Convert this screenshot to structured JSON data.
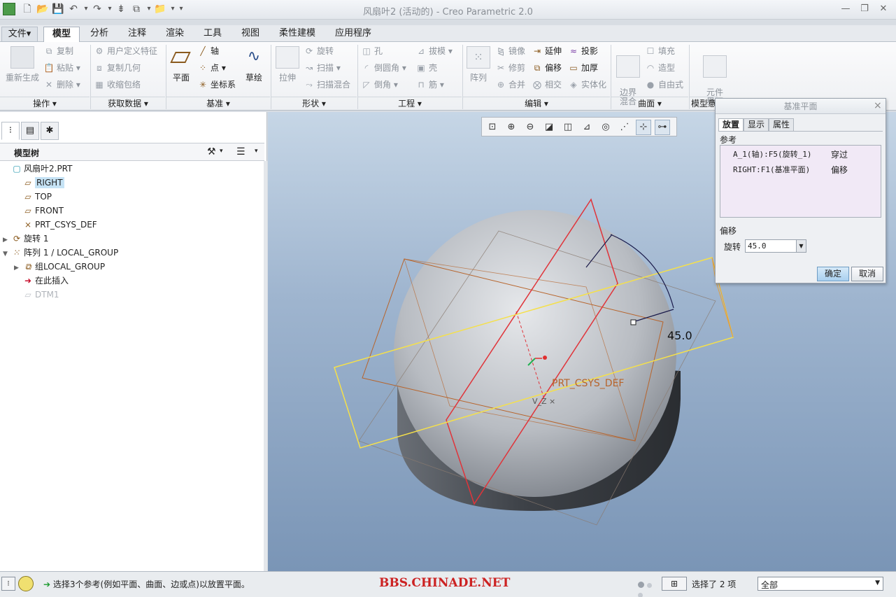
{
  "window": {
    "title": "风扇叶2 (活动的) - Creo Parametric 2.0",
    "minimize": "—",
    "restore": "❐",
    "close": "✕"
  },
  "quick_access": [
    "▣",
    "🗋",
    "📂",
    "💾",
    "↶",
    "▾",
    "↷",
    "▾",
    "⇟",
    "⧉",
    "▾",
    "📁",
    "▾",
    "▾"
  ],
  "top_right_icons": {
    "collapse": "^",
    "search": "⌕",
    "help_settings": "⚙",
    "help": "?"
  },
  "tabs": [
    {
      "label": "文件▾",
      "kind": "file"
    },
    {
      "label": "模型",
      "kind": "active"
    },
    {
      "label": "分析"
    },
    {
      "label": "注释"
    },
    {
      "label": "渲染"
    },
    {
      "label": "工具"
    },
    {
      "label": "视图"
    },
    {
      "label": "柔性建模"
    },
    {
      "label": "应用程序"
    }
  ],
  "ribbon": {
    "operations": {
      "regenerate": "重新生成",
      "copy": "复制",
      "paste": "粘贴",
      "delete": "删除",
      "label": "操作 ▾"
    },
    "get_data": {
      "udf": "用户定义特征",
      "copy_geometry": "复制几何",
      "shrinkwrap": "收缩包络",
      "label": "获取数据 ▾"
    },
    "datum": {
      "plane": "平面",
      "axis": "轴",
      "point": "点",
      "csys": "坐标系",
      "sketch": "草绘",
      "label": "基准 ▾"
    },
    "shapes": {
      "extrude": "拉伸",
      "revolve": "旋转",
      "sweep": "扫描",
      "swept_blend": "扫描混合",
      "label": "形状 ▾"
    },
    "engineering": {
      "hole": "孔",
      "draft": "拔模",
      "round": "倒圆角",
      "shell": "壳",
      "chamfer": "倒角",
      "rib": "筋",
      "label": "工程 ▾"
    },
    "editing": {
      "pattern": "阵列",
      "mirror": "镜像",
      "extend": "延伸",
      "project": "投影",
      "trim": "修剪",
      "offset": "偏移",
      "thicken": "加厚",
      "merge": "合并",
      "intersect": "相交",
      "solidify": "实体化",
      "label": "编辑 ▾"
    },
    "surfaces": {
      "boundary_blend": "边界\n混合",
      "fill": "填充",
      "style": "造型",
      "freestyle": "自由式",
      "label": "曲面 ▾"
    },
    "model_intent": {
      "component_interface": "元件\n界面",
      "label": "模型意"
    }
  },
  "left_panel": {
    "nav_tabs": [
      "⁝",
      "▤",
      "✱"
    ],
    "tree_title": "模型树",
    "tree_tools": [
      "⚒",
      "▾",
      "☰",
      "▾"
    ],
    "items": [
      {
        "label": "风扇叶2.PRT",
        "icon": "part-icon",
        "glyph": "▢",
        "indent": 0,
        "twisty": ""
      },
      {
        "label": "RIGHT",
        "icon": "datum-plane-icon",
        "glyph": "▱",
        "indent": 1,
        "twisty": "",
        "selected": true
      },
      {
        "label": "TOP",
        "icon": "datum-plane-icon",
        "glyph": "▱",
        "indent": 1,
        "twisty": ""
      },
      {
        "label": "FRONT",
        "icon": "datum-plane-icon",
        "glyph": "▱",
        "indent": 1,
        "twisty": ""
      },
      {
        "label": "PRT_CSYS_DEF",
        "icon": "csys-icon",
        "glyph": "⨯",
        "indent": 1,
        "twisty": ""
      },
      {
        "label": "旋转 1",
        "icon": "revolve-icon",
        "glyph": "⟳",
        "indent": 0,
        "twisty": "▶"
      },
      {
        "label": "阵列 1 / LOCAL_GROUP",
        "icon": "pattern-icon",
        "glyph": "⁙",
        "indent": 0,
        "twisty": "▼"
      },
      {
        "label": "组LOCAL_GROUP",
        "icon": "group-icon",
        "glyph": "⧉",
        "indent": 1,
        "twisty": "▶"
      },
      {
        "label": "在此插入",
        "icon": "insert-here-icon",
        "glyph": "➜",
        "indent": 1,
        "twisty": ""
      },
      {
        "label": "DTM1",
        "icon": "datum-plane-icon",
        "glyph": "▱",
        "indent": 1,
        "twisty": "",
        "dim": true
      }
    ]
  },
  "view_toolbar": [
    "⊡",
    "⊕",
    "⊖",
    "◪",
    "◫",
    "⊿",
    "◎",
    "⋰",
    "⊹",
    "⊶"
  ],
  "viewport_labels": {
    "csys": "PRT_CSYS_DEF",
    "angle": "45.0",
    "small_label": "V_Z ×"
  },
  "dialog": {
    "title": "基准平面",
    "close": "×",
    "tabs": [
      "放置",
      "显示",
      "属性"
    ],
    "references_label": "参考",
    "references": [
      {
        "ref": "A_1(轴):F5(旋转_1)",
        "type": "穿过"
      },
      {
        "ref": "RIGHT:F1(基准平面)",
        "type": "偏移"
      }
    ],
    "offset_label": "偏移",
    "rotation_label": "旋转",
    "rotation_value": "45.0",
    "ok": "确定",
    "cancel": "取消"
  },
  "status": {
    "message": "选择3个参考(例如平面、曲面、边或点)以放置平面。",
    "watermark": "BBS.CHINADE.NET",
    "selected": "选择了 2 项",
    "filter": "全部"
  },
  "colors": {
    "accent": "#2e7bc6",
    "yellow_plane": "#f5e04a",
    "red_plane": "#e0343a",
    "orange_plane": "#c86a2a",
    "watermark": "#cc2222"
  }
}
